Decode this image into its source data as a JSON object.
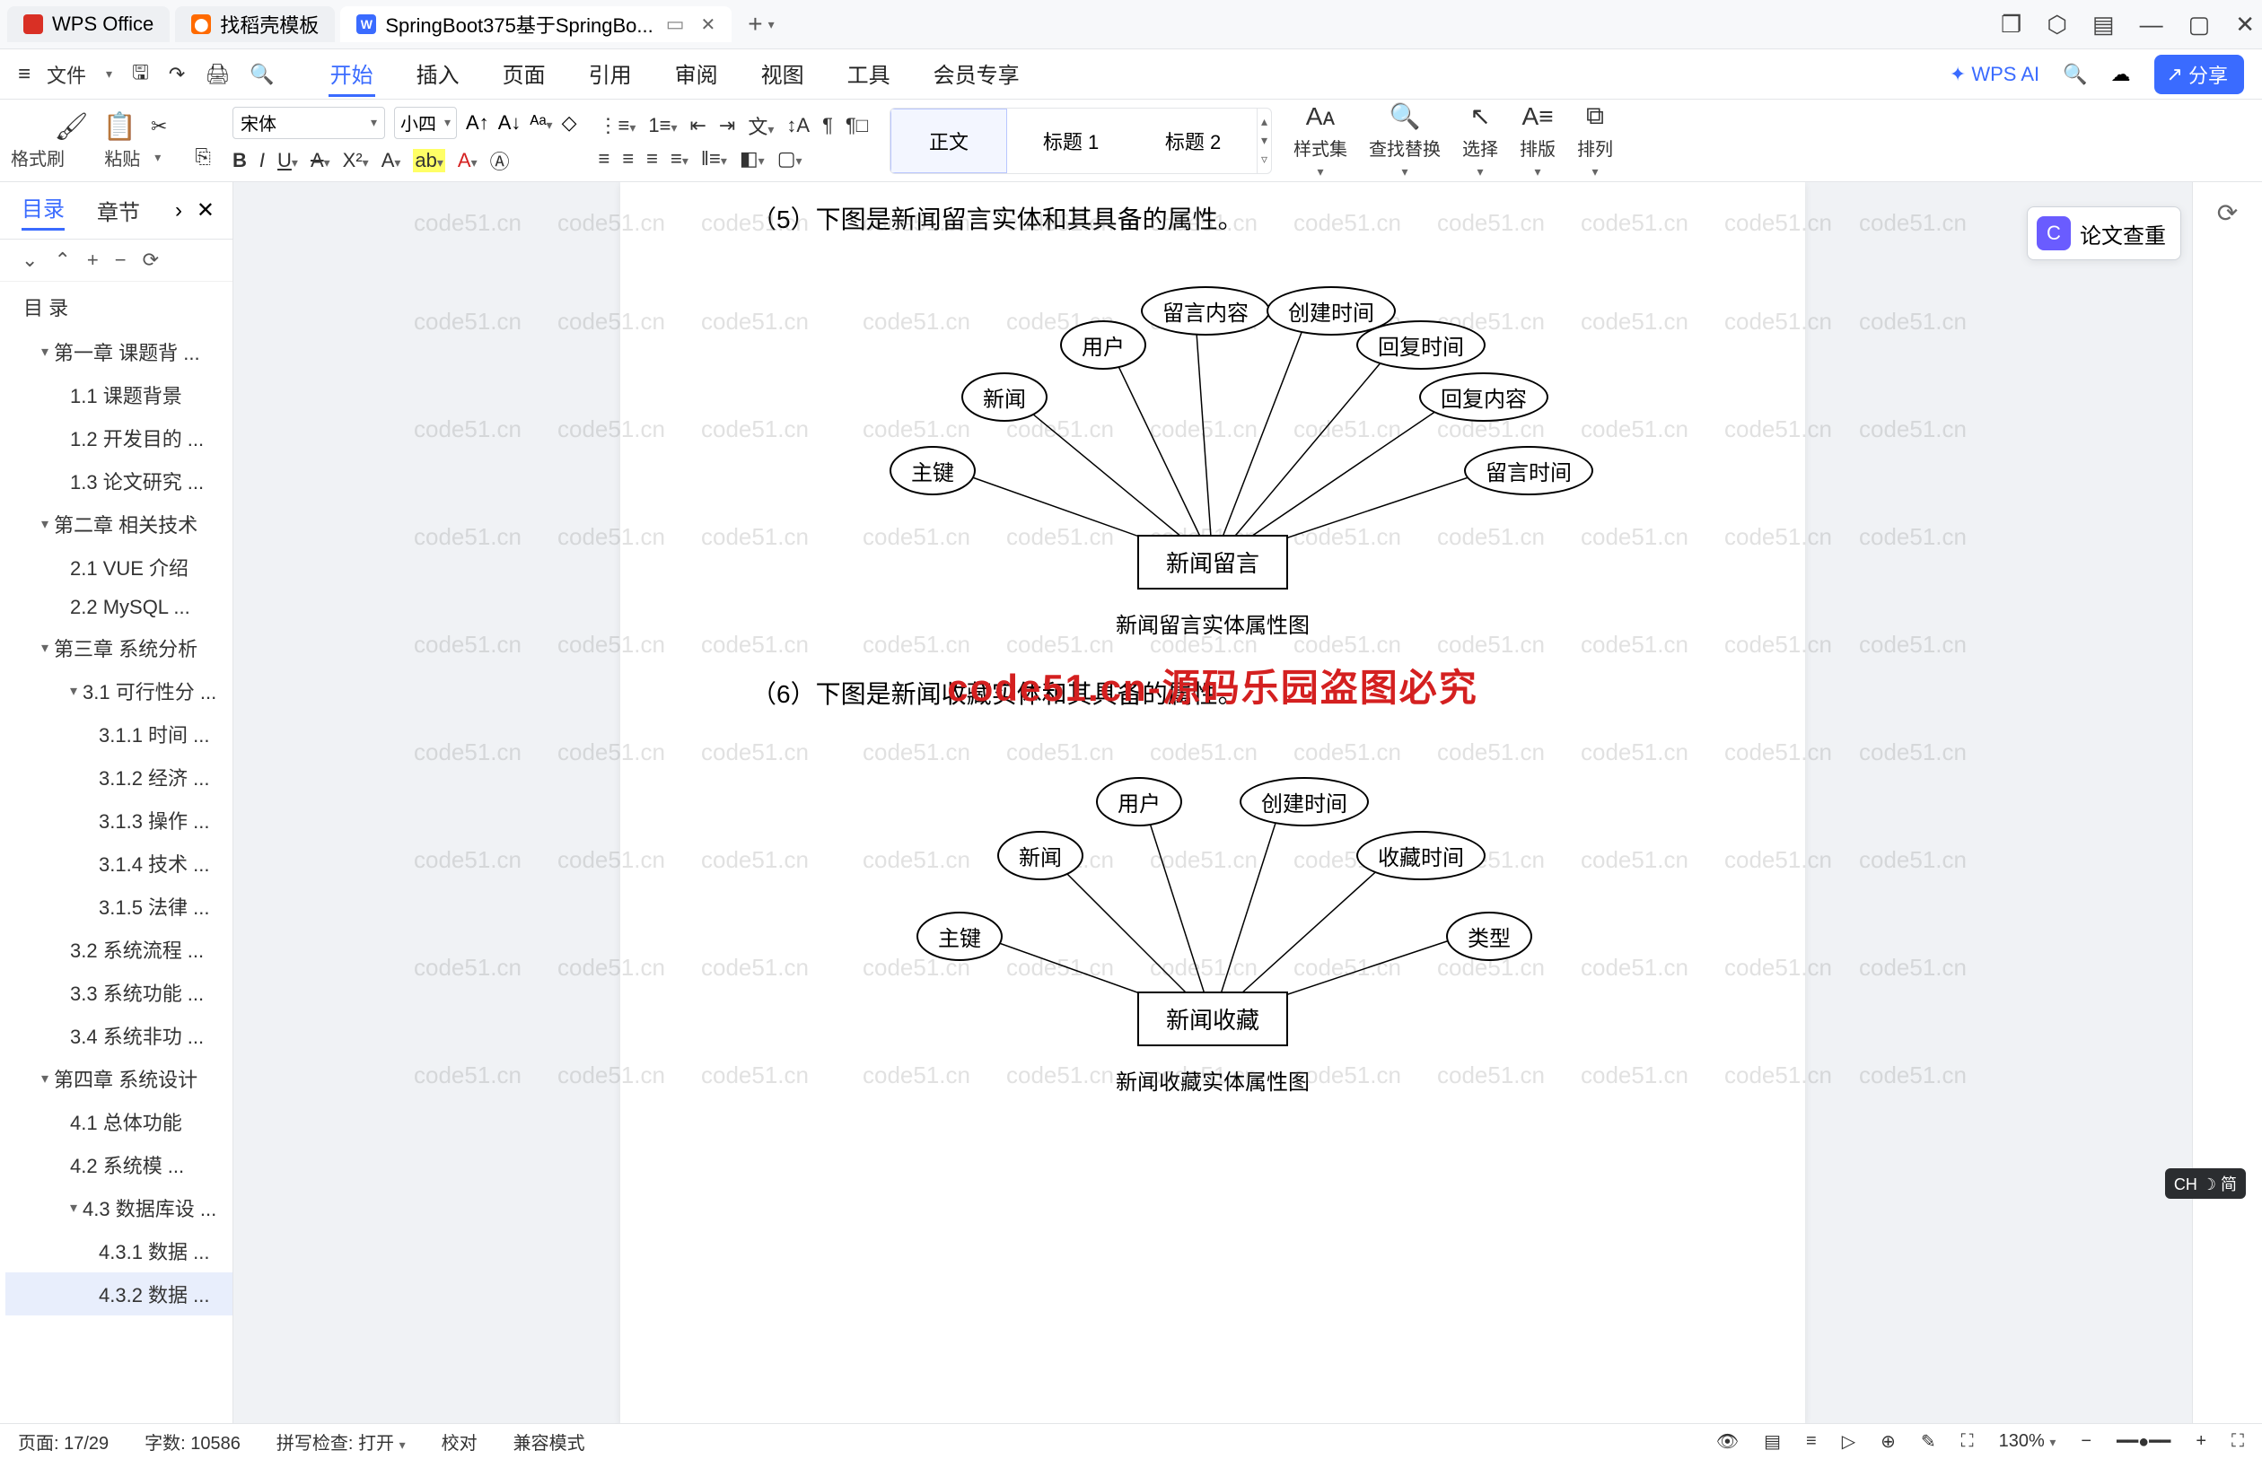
{
  "titlebar": {
    "tabs": [
      {
        "icon": "wps",
        "label": "WPS Office"
      },
      {
        "icon": "doc-orange",
        "label": "找稻壳模板"
      },
      {
        "icon": "doc-blue",
        "label": "SpringBoot375基于SpringBo..."
      }
    ],
    "plus": "+",
    "right_icons": [
      "❐",
      "⬡",
      "▤",
      "—",
      "❐",
      "✕"
    ]
  },
  "menubar": {
    "file": "文件",
    "menus": [
      "开始",
      "插入",
      "页面",
      "引用",
      "审阅",
      "视图",
      "工具",
      "会员专享"
    ],
    "wpsai": "WPS AI",
    "share": "分享"
  },
  "ribbon": {
    "format_painter": "格式刷",
    "paste": "粘贴",
    "font_family": "宋体",
    "font_size": "小四",
    "styles": {
      "s1": "正文",
      "s2": "标题 1",
      "s3": "标题 2"
    },
    "style_set": "样式集",
    "find_replace": "查找替换",
    "select": "选择",
    "arrange": "排版",
    "layout": "排列"
  },
  "sidebar": {
    "tab1": "目录",
    "tab2": "章节",
    "toc_heading": "目    录",
    "items": [
      {
        "d": 1,
        "tri": true,
        "label": "第一章  课题背 ..."
      },
      {
        "d": 2,
        "label": "1.1  课题背景"
      },
      {
        "d": 2,
        "label": "1.2  开发目的 ..."
      },
      {
        "d": 2,
        "label": "1.3  论文研究 ..."
      },
      {
        "d": 1,
        "tri": true,
        "label": "第二章  相关技术"
      },
      {
        "d": 2,
        "label": "2.1 VUE 介绍"
      },
      {
        "d": 2,
        "label": "2.2 MySQL ..."
      },
      {
        "d": 1,
        "tri": true,
        "label": "第三章  系统分析"
      },
      {
        "d": 2,
        "tri": true,
        "label": "3.1  可行性分 ..."
      },
      {
        "d": 3,
        "label": "3.1.1  时间 ..."
      },
      {
        "d": 3,
        "label": "3.1.2  经济 ..."
      },
      {
        "d": 3,
        "label": "3.1.3  操作 ..."
      },
      {
        "d": 3,
        "label": "3.1.4  技术 ..."
      },
      {
        "d": 3,
        "label": "3.1.5  法律 ..."
      },
      {
        "d": 2,
        "label": "3.2  系统流程 ..."
      },
      {
        "d": 2,
        "label": "3.3  系统功能 ..."
      },
      {
        "d": 2,
        "label": "3.4  系统非功 ..."
      },
      {
        "d": 1,
        "tri": true,
        "label": "第四章  系统设计"
      },
      {
        "d": 2,
        "label": "4.1  总体功能"
      },
      {
        "d": 2,
        "label": "4.2  系统模 ..."
      },
      {
        "d": 2,
        "tri": true,
        "label": "4.3  数据库设 ..."
      },
      {
        "d": 3,
        "label": "4.3.1  数据 ..."
      },
      {
        "d": 3,
        "sel": true,
        "label": "4.3.2  数据 ..."
      }
    ]
  },
  "document": {
    "para5": "（5）下图是新闻留言实体和其具备的属性。",
    "fig5": {
      "entity": "新闻留言",
      "attrs": [
        "主键",
        "新闻",
        "用户",
        "留言内容",
        "创建时间",
        "回复时间",
        "回复内容",
        "留言时间"
      ],
      "caption": "新闻留言实体属性图"
    },
    "para6": "（6）下图是新闻收藏实体和其具备的属性。",
    "fig6": {
      "entity": "新闻收藏",
      "attrs": [
        "主键",
        "新闻",
        "用户",
        "创建时间",
        "收藏时间",
        "类型"
      ],
      "caption": "新闻收藏实体属性图"
    },
    "overlay": "code51.cn-源码乐园盗图必究",
    "watermark": "code51.cn"
  },
  "right_panel": {
    "paper_check": "论文查重"
  },
  "status": {
    "page": "页面: 17/29",
    "words": "字数: 10586",
    "spell": "拼写检查: 打开",
    "proof": "校对",
    "compat": "兼容模式",
    "zoom": "130%"
  },
  "ime": "CH ☽ 简"
}
